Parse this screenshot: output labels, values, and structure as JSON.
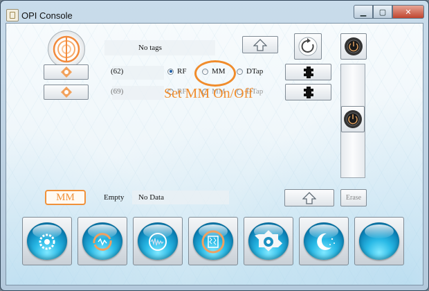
{
  "window": {
    "title": "OPI Console"
  },
  "top": {
    "tag_text": "No tags"
  },
  "rows": [
    {
      "count": "(62)",
      "radios": [
        "RF",
        "MM",
        "DTap"
      ],
      "selected": "RF",
      "enabled": true
    },
    {
      "count": "(69)",
      "radios": [
        "RF",
        "MM",
        "DTap"
      ],
      "selected": "",
      "enabled": false
    }
  ],
  "annotation": {
    "text": "Set MM On/Off"
  },
  "bottom": {
    "mode_label": "MM",
    "status_label": "Empty",
    "status_value": "No Data",
    "erase_label": "Erase"
  },
  "toolbar": {
    "buttons": [
      "gear-icon",
      "refresh-wave-icon",
      "waveform-icon",
      "data-matrix-icon",
      "target-icon",
      "moon-icon",
      "blank-icon"
    ]
  },
  "colors": {
    "accent": "#f08c2c",
    "orb": "#29b9e6"
  }
}
